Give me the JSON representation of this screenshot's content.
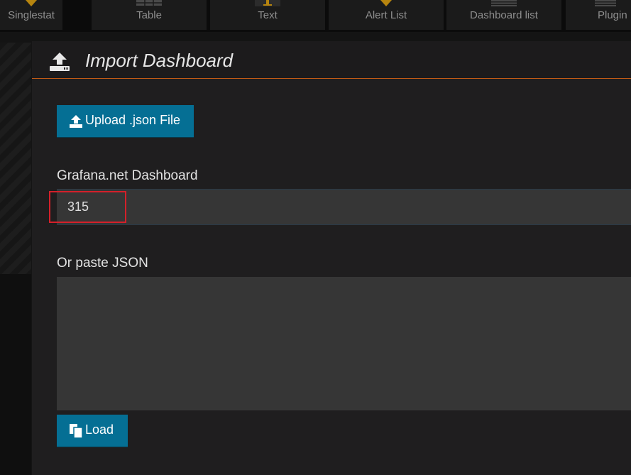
{
  "panel_types": [
    {
      "label": "Singlestat",
      "icon": "singlestat-icon"
    },
    {
      "label": "Table",
      "icon": "table-icon"
    },
    {
      "label": "Text",
      "icon": "text-icon"
    },
    {
      "label": "Alert List",
      "icon": "alert-list-icon"
    },
    {
      "label": "Dashboard list",
      "icon": "dashboard-list-icon"
    },
    {
      "label": "Plugin",
      "icon": "plugin-icon"
    }
  ],
  "modal": {
    "title": "Import Dashboard",
    "title_icon": "upload-icon",
    "accent_color": "#c15a15"
  },
  "upload": {
    "label": "Upload .json File",
    "icon": "upload-icon"
  },
  "grafana_net": {
    "label": "Grafana.net Dashboard",
    "value": "315",
    "highlight_color": "#d4202a"
  },
  "paste_json": {
    "label": "Or paste JSON",
    "value": ""
  },
  "load": {
    "label": "Load",
    "icon": "copy-icon"
  },
  "colors": {
    "primary_button": "#056f94",
    "panel_background": "#1f1e1f",
    "input_background": "#363636"
  }
}
